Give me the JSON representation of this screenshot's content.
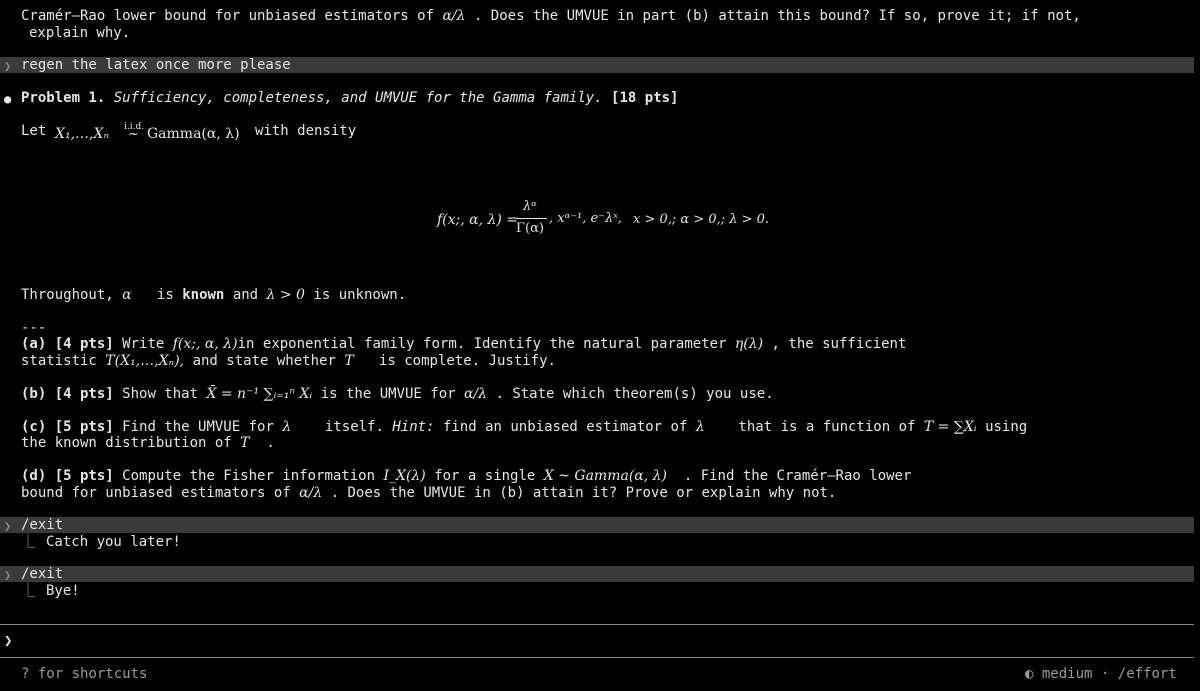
{
  "prev_text": {
    "line1": "Cramér–Rao lower bound for unbiased estimators of",
    "line1_math": "α/λ",
    "line1_rest": ". Does the UMVUE in part (b) attain this bound? If so, prove it; if not,",
    "line2": "explain why."
  },
  "user_prompt": "regen the latex once more please",
  "problem": {
    "bullet": "●",
    "label": "Problem 1.",
    "title": "Sufficiency, completeness, and UMVUE for the Gamma family.",
    "points": "[18 pts]",
    "let_word": "Let",
    "let_math": "X₁,…,Xₙ",
    "iid": "i.i.d.",
    "tilde": "~",
    "dist": "Gamma(α, λ)",
    "with_density": "with density",
    "density_lhs": "f(x;, α, λ) =",
    "density_num": "λᵅ",
    "density_den": "Γ(α)",
    "density_rest": ", xᵅ⁻¹, e⁻λˣ,",
    "density_cond": "x > 0,; α > 0,; λ > 0.",
    "throughout_1": "Throughout,",
    "throughout_a": "α",
    "throughout_2": "is",
    "throughout_known": "known",
    "throughout_3": "and",
    "throughout_lam": "λ > 0",
    "throughout_4": "is unknown.",
    "sep": "---"
  },
  "parts": {
    "a_label": "(a) [4 pts]",
    "a_text1": "Write",
    "a_math1": "f(x;, α, λ)",
    "a_text2": "in exponential family form. Identify the natural parameter",
    "a_math2": "η(λ)",
    "a_text3": ", the sufficient",
    "a_line2_1": "statistic",
    "a_line2_m1": "T(X₁,…,Xₙ),",
    "a_line2_2": "and state whether",
    "a_line2_m2": "T",
    "a_line2_3": "is complete. Justify.",
    "b_label": "(b) [4 pts]",
    "b_text1": "Show that",
    "b_math1": "X̄ = n⁻¹ ∑ᵢ₌₁ⁿ Xᵢ",
    "b_text2": "is the UMVUE for",
    "b_math2": "α/λ",
    "b_text3": ". State which theorem(s) you use.",
    "c_label": "(c) [5 pts]",
    "c_text1": "Find the UMVUE for",
    "c_math1": "λ",
    "c_text2": "itself.",
    "c_hint": "Hint:",
    "c_text3": "find an unbiased estimator of",
    "c_math2": "λ",
    "c_text4": "that is a function of",
    "c_math3": "T = ∑Xᵢ",
    "c_text5": "using",
    "c_line2": "the known distribution of",
    "c_math4": "T",
    "c_dot": ".",
    "d_label": "(d) [5 pts]",
    "d_text1": "Compute the Fisher information",
    "d_math1": "I_X(λ)",
    "d_text2": "for a single",
    "d_math2": "X ~ Gamma(α, λ)",
    "d_text3": ". Find the Cramér–Rao lower",
    "d_line2_1": "bound for unbiased estimators of",
    "d_math3": "α/λ",
    "d_line2_2": ". Does the UMVUE in (b) attain it? Prove or explain why not."
  },
  "exit1": {
    "cmd": "/exit",
    "reply": "Catch you later!"
  },
  "exit2": {
    "cmd": "/exit",
    "reply": "Bye!"
  },
  "input_prompt": "❯",
  "footer": {
    "shortcuts": "? for shortcuts",
    "effort_icon": "◐",
    "effort_level": "medium",
    "separator": "·",
    "effort_cmd": "/effort"
  }
}
